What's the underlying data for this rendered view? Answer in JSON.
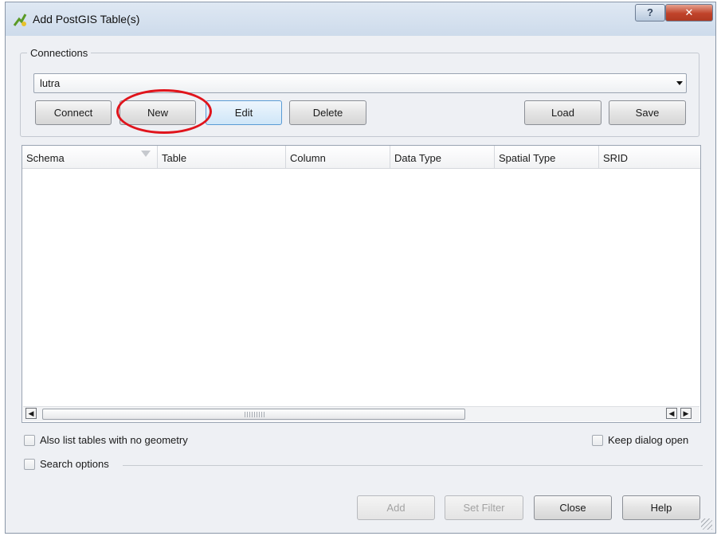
{
  "window": {
    "title": "Add PostGIS Table(s)",
    "help_glyph": "?",
    "close_glyph": "✕"
  },
  "connections": {
    "group_title": "Connections",
    "selected": "lutra",
    "buttons": {
      "connect": "Connect",
      "new": "New",
      "edit": "Edit",
      "delete": "Delete",
      "load": "Load",
      "save": "Save"
    },
    "highlighted_button": "New",
    "highlight_color": "#e0141c"
  },
  "table": {
    "columns": [
      "Schema",
      "Table",
      "Column",
      "Data Type",
      "Spatial Type",
      "SRID"
    ],
    "rows": []
  },
  "options": {
    "also_list_tables": {
      "label": "Also list tables with no geometry",
      "checked": false
    },
    "keep_dialog_open": {
      "label": "Keep dialog open",
      "checked": false
    },
    "search_options": {
      "label": "Search options",
      "checked": false
    }
  },
  "footer_buttons": {
    "add": {
      "label": "Add",
      "enabled": false
    },
    "set_filter": {
      "label": "Set Filter",
      "enabled": false
    },
    "close": {
      "label": "Close",
      "enabled": true
    },
    "help": {
      "label": "Help",
      "enabled": true
    }
  }
}
